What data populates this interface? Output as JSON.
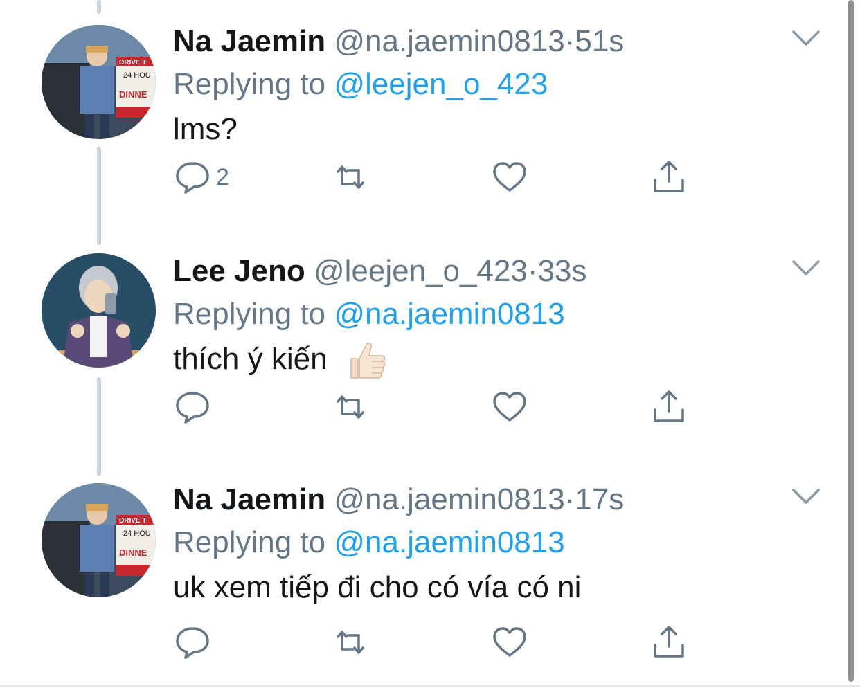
{
  "tweets": [
    {
      "name": "Na Jaemin",
      "handle": "@na.jaemin0813",
      "time": "51s",
      "replying_label": "Replying to",
      "replying_to": "@leejen_o_423",
      "text": "lms?",
      "reply_count": "2",
      "avatar_sign_lines": [
        "DRIVE T",
        "24 HOU",
        "DINNE"
      ]
    },
    {
      "name": "Lee Jeno",
      "handle": "@leejen_o_423",
      "time": "33s",
      "replying_label": "Replying to",
      "replying_to": "@na.jaemin0813",
      "text": "thích ý kiến",
      "emoji": "thumbs-up-light-skin",
      "reply_count": ""
    },
    {
      "name": "Na Jaemin",
      "handle": "@na.jaemin0813",
      "time": "17s",
      "replying_label": "Replying to",
      "replying_to": "@na.jaemin0813",
      "text": "uk xem tiếp đi cho có vía có ni",
      "reply_count": "",
      "avatar_sign_lines": [
        "DRIVE T",
        "24 HOU",
        "DINNE"
      ]
    }
  ],
  "separator": "·",
  "colors": {
    "name": "#14171a",
    "secondary": "#657786",
    "link": "#1da1f2",
    "thread_line": "#c9d3dc"
  }
}
